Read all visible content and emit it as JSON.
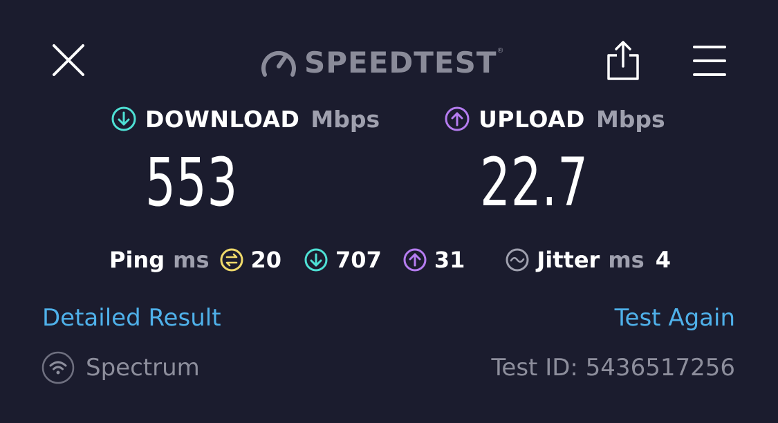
{
  "header": {
    "logo_text": "SPEEDTEST",
    "logo_tm": "®",
    "close_icon": "close-icon",
    "share_icon": "share-icon",
    "menu_icon": "hamburger-menu-icon"
  },
  "download": {
    "label": "DOWNLOAD",
    "unit": "Mbps",
    "value": "553",
    "icon": "download-arrow-icon",
    "color": "#4ee0d4"
  },
  "upload": {
    "label": "UPLOAD",
    "unit": "Mbps",
    "value": "22.7",
    "icon": "upload-arrow-icon",
    "color": "#b57cf0"
  },
  "ping": {
    "label": "Ping",
    "unit": "ms",
    "idle_value": "20",
    "download_value": "707",
    "upload_value": "31",
    "idle_color": "#efd96a"
  },
  "jitter": {
    "label": "Jitter",
    "unit": "ms",
    "value": "4",
    "icon": "jitter-wave-icon"
  },
  "links": {
    "detailed_result": "Detailed Result",
    "test_again": "Test Again",
    "color": "#4fb1ea"
  },
  "footer": {
    "isp_name": "Spectrum",
    "isp_icon": "wifi-icon",
    "test_id": "Test ID: 5436517256"
  }
}
